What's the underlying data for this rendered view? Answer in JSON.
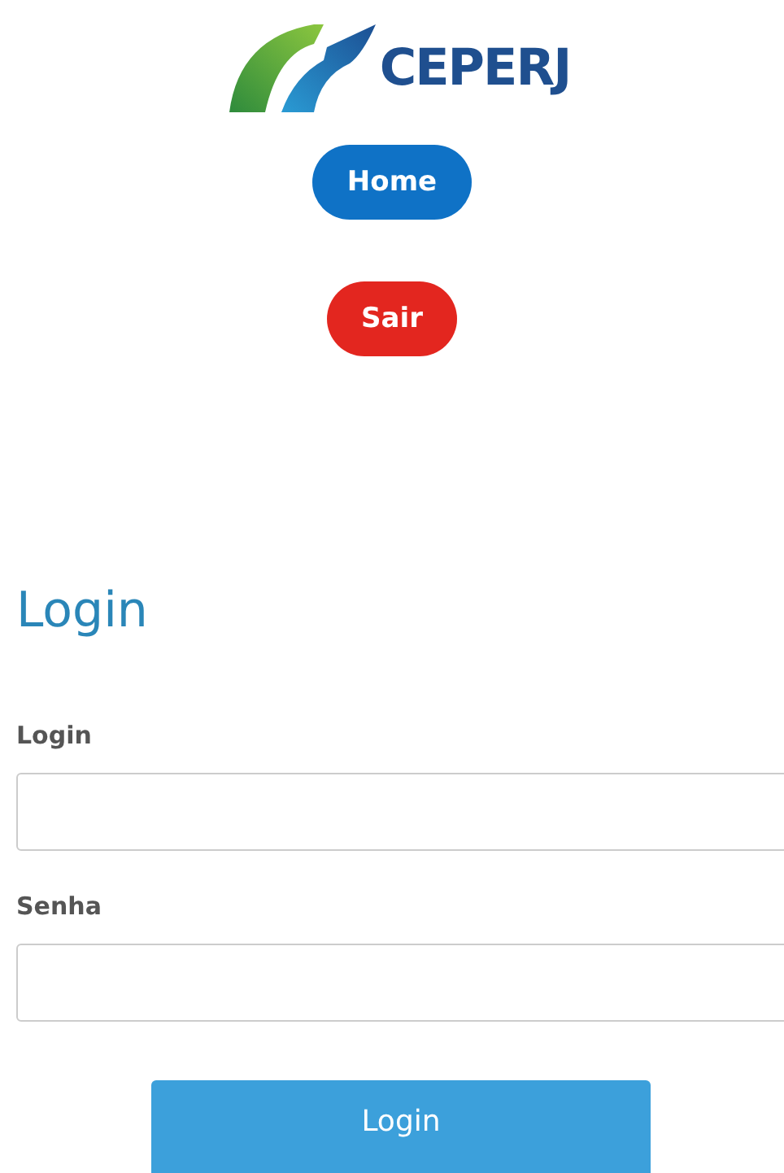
{
  "logo": {
    "text": "CEPERJ"
  },
  "nav_buttons": [
    {
      "label": "Home",
      "color": "#0f72c6"
    },
    {
      "label": "Sair",
      "color": "#e3261f"
    }
  ],
  "form": {
    "title": "Login",
    "fields": [
      {
        "label": "Login"
      },
      {
        "label": "Senha"
      }
    ],
    "submit": "Login"
  }
}
